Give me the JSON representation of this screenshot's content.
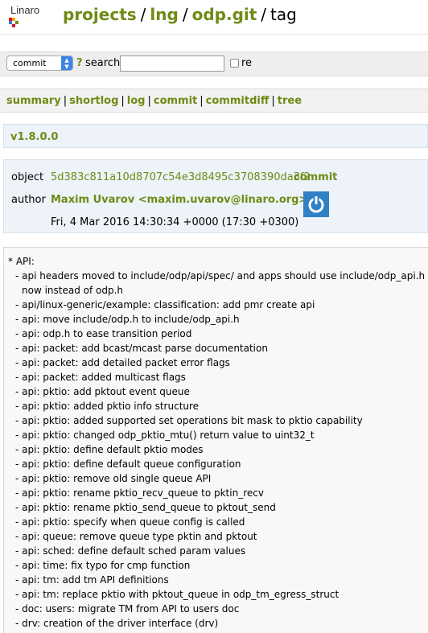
{
  "header": {
    "logo_text": "Linaro",
    "crumbs": [
      "projects",
      "lng",
      "odp.git"
    ],
    "current": "tag"
  },
  "search": {
    "select_value": "commit",
    "help": "?",
    "label": "search:",
    "input_value": "",
    "regex_label": "re"
  },
  "nav": {
    "links": [
      "summary",
      "shortlog",
      "log",
      "commit",
      "commitdiff",
      "tree"
    ]
  },
  "tag": {
    "name": "v1.8.0.0"
  },
  "meta": {
    "object_label": "object",
    "object_hash": "5d383c811a10d8707c54e3d8495c3708390da3f2",
    "object_link": "commit",
    "author_label": "author",
    "author": "Maxim Uvarov <maxim.uvarov@linaro.org>",
    "date": "Fri, 4 Mar 2016 14:30:34 +0000 (17:30 +0300)"
  },
  "message": [
    "* API:",
    "  - api headers moved to include/odp/api/spec/ and apps should use include/odp_api.h",
    "    now instead of odp.h",
    "  - api/linux-generic/example: classification: add pmr create api",
    "  - api: move include/odp.h to include/odp_api.h",
    "  - api: odp.h to ease transition period",
    "  - api: packet: add bcast/mcast parse documentation",
    "  - api: packet: add detailed packet error flags",
    "  - api: packet: added multicast flags",
    "  - api: pktio: add pktout event queue",
    "  - api: pktio: added pktio info structure",
    "  - api: pktio: added supported set operations bit mask to pktio capability",
    "  - api: pktio: changed odp_pktio_mtu() return value to uint32_t",
    "  - api: pktio: define default pktio modes",
    "  - api: pktio: define default queue configuration",
    "  - api: pktio: remove old single queue API",
    "  - api: pktio: rename pktio_recv_queue to pktin_recv",
    "  - api: pktio: rename pktio_send_queue to pktout_send",
    "  - api: pktio: specify when queue config is called",
    "  - api: queue: remove queue type pktin and pktout",
    "  - api: sched: define default sched param values",
    "  - api: time: fix typo for cmp function",
    "  - api: tm: add tm API definitions",
    "  - api: tm: replace pktio with pktout_queue in odp_tm_egress_struct",
    "  - doc: users: migrate TM from API to users doc",
    "  - drv: creation of the driver interface (drv)"
  ],
  "colors": {
    "link": "#6f8a15",
    "avatar": "#2f81c4",
    "meta_bg": "#edf3f8"
  }
}
